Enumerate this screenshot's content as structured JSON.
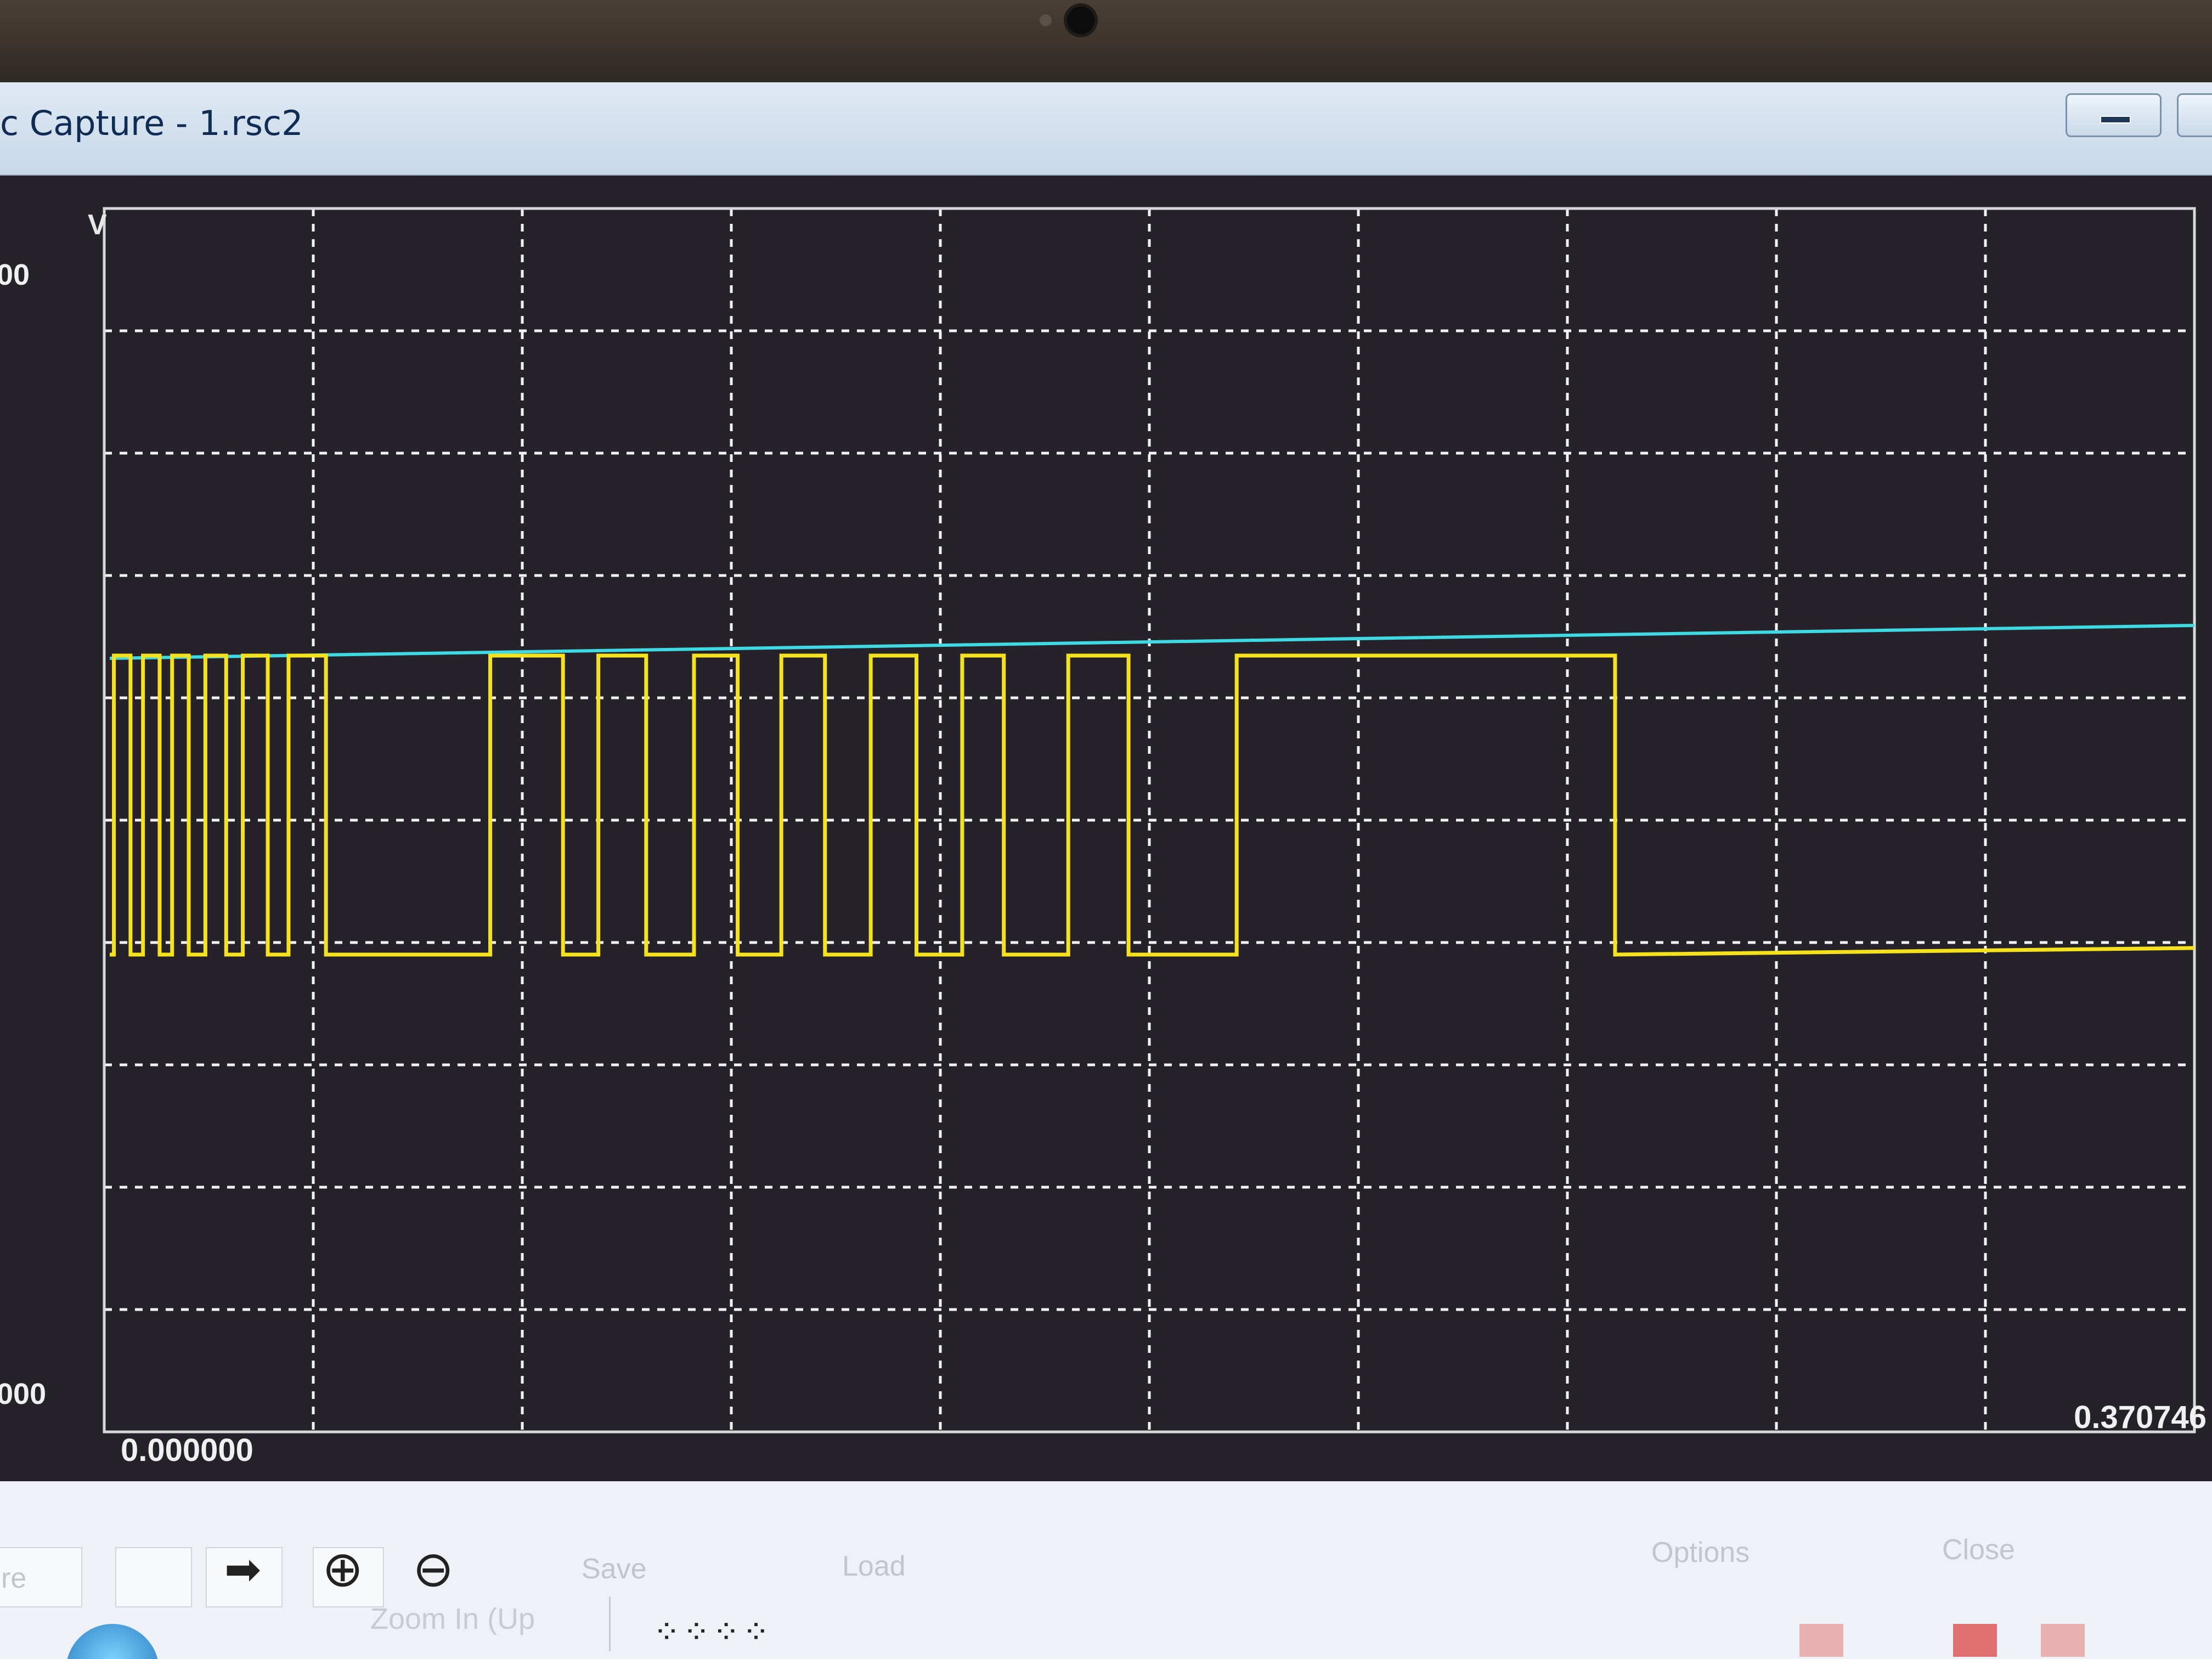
{
  "window": {
    "title": "c Capture - 1.rsc2"
  },
  "scope": {
    "y_unit": "V",
    "y_top_label": "00",
    "y_bottom_label": "000",
    "x_start_label": "0.000000",
    "x_end_label": "0.370746",
    "colors": {
      "background": "#25222a",
      "grid": "#f2f2f2",
      "signal": "#f5e21c",
      "trigger_line": "#3fd9e4"
    }
  },
  "toolbar": {
    "left_partial_label": "re",
    "arrow_icon": "arrow-right-icon",
    "zoom_in_icon": "zoom-in-icon",
    "zoom_out_icon": "zoom-out-icon",
    "save_label": "Save",
    "load_label": "Load",
    "options_label": "Options",
    "close_label": "Close",
    "status_text": "Zoom In (Up"
  }
}
